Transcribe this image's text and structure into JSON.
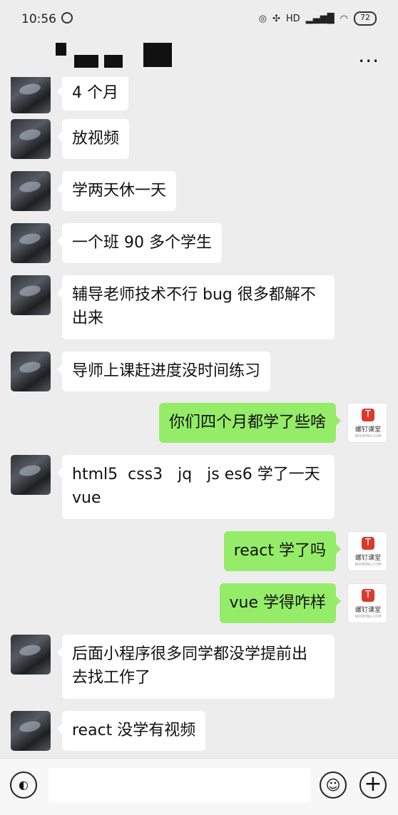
{
  "status_bar": {
    "time": "10:56",
    "signal_text": "HD",
    "battery": "72"
  },
  "header": {
    "more_label": "..."
  },
  "messages": [
    {
      "side": "left",
      "text": "4 个月"
    },
    {
      "side": "left",
      "text": "放视频"
    },
    {
      "side": "left",
      "text": "学两天休一天"
    },
    {
      "side": "left",
      "text": "一个班 90 多个学生"
    },
    {
      "side": "left",
      "text": "辅导老师技术不行 bug 很多都解不\n出来"
    },
    {
      "side": "left",
      "text": "导师上课赶进度没时间练习"
    },
    {
      "side": "right",
      "text": "你们四个月都学了些啥"
    },
    {
      "side": "left",
      "text": "html5  css3   jq   js es6 学了一天\nvue"
    },
    {
      "side": "right",
      "text": "react 学了吗"
    },
    {
      "side": "right",
      "text": "vue 学得咋样"
    },
    {
      "side": "left",
      "text": "后面小程序很多同学都没学提前出\n去找工作了"
    },
    {
      "side": "left",
      "text": "react 没学有视频"
    }
  ],
  "brand": {
    "logo_letter": "T",
    "name": "螺钉课堂",
    "url": "NODEING.COM"
  },
  "input": {
    "placeholder": ""
  },
  "icons": {
    "voice": "voice-icon",
    "emoji": "emoji-icon",
    "plus": "plus-icon"
  }
}
